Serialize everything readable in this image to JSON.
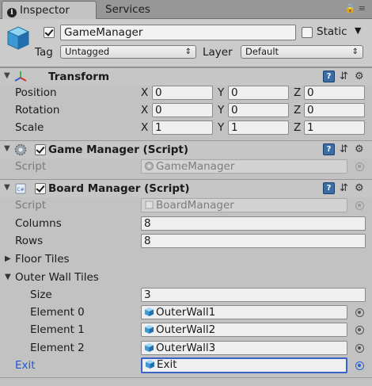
{
  "tabs": {
    "inspector": "Inspector",
    "services": "Services"
  },
  "gameobject": {
    "active": true,
    "name": "GameManager",
    "static_label": "Static",
    "static_checked": false,
    "tag_label": "Tag",
    "tag_value": "Untagged",
    "layer_label": "Layer",
    "layer_value": "Default"
  },
  "transform": {
    "title": "Transform",
    "position": {
      "label": "Position",
      "x": "0",
      "y": "0",
      "z": "0"
    },
    "rotation": {
      "label": "Rotation",
      "x": "0",
      "y": "0",
      "z": "0"
    },
    "scale": {
      "label": "Scale",
      "x": "1",
      "y": "1",
      "z": "1"
    },
    "axes": {
      "x": "X",
      "y": "Y",
      "z": "Z"
    }
  },
  "game_manager": {
    "title": "Game Manager (Script)",
    "enabled": true,
    "script_label": "Script",
    "script_value": "GameManager"
  },
  "board_manager": {
    "title": "Board Manager (Script)",
    "enabled": true,
    "script_label": "Script",
    "script_value": "BoardManager",
    "columns_label": "Columns",
    "columns_value": "8",
    "rows_label": "Rows",
    "rows_value": "8",
    "floor_tiles_label": "Floor Tiles",
    "outer_wall_tiles_label": "Outer Wall Tiles",
    "size_label": "Size",
    "size_value": "3",
    "elements": [
      {
        "label": "Element 0",
        "value": "OuterWall1"
      },
      {
        "label": "Element 1",
        "value": "OuterWall2"
      },
      {
        "label": "Element 2",
        "value": "OuterWall3"
      }
    ],
    "exit_label": "Exit",
    "exit_value": "Exit"
  },
  "colors": {
    "accent": "#1f57d6",
    "panel": "#c2c2c2",
    "help_icon": "#3b6ea8"
  },
  "icons": [
    "info-icon",
    "lock-icon",
    "menu-icon",
    "cube-icon",
    "transform-icon",
    "gear-icon",
    "script-icon",
    "help-icon",
    "preset-icon",
    "object-picker-icon"
  ]
}
